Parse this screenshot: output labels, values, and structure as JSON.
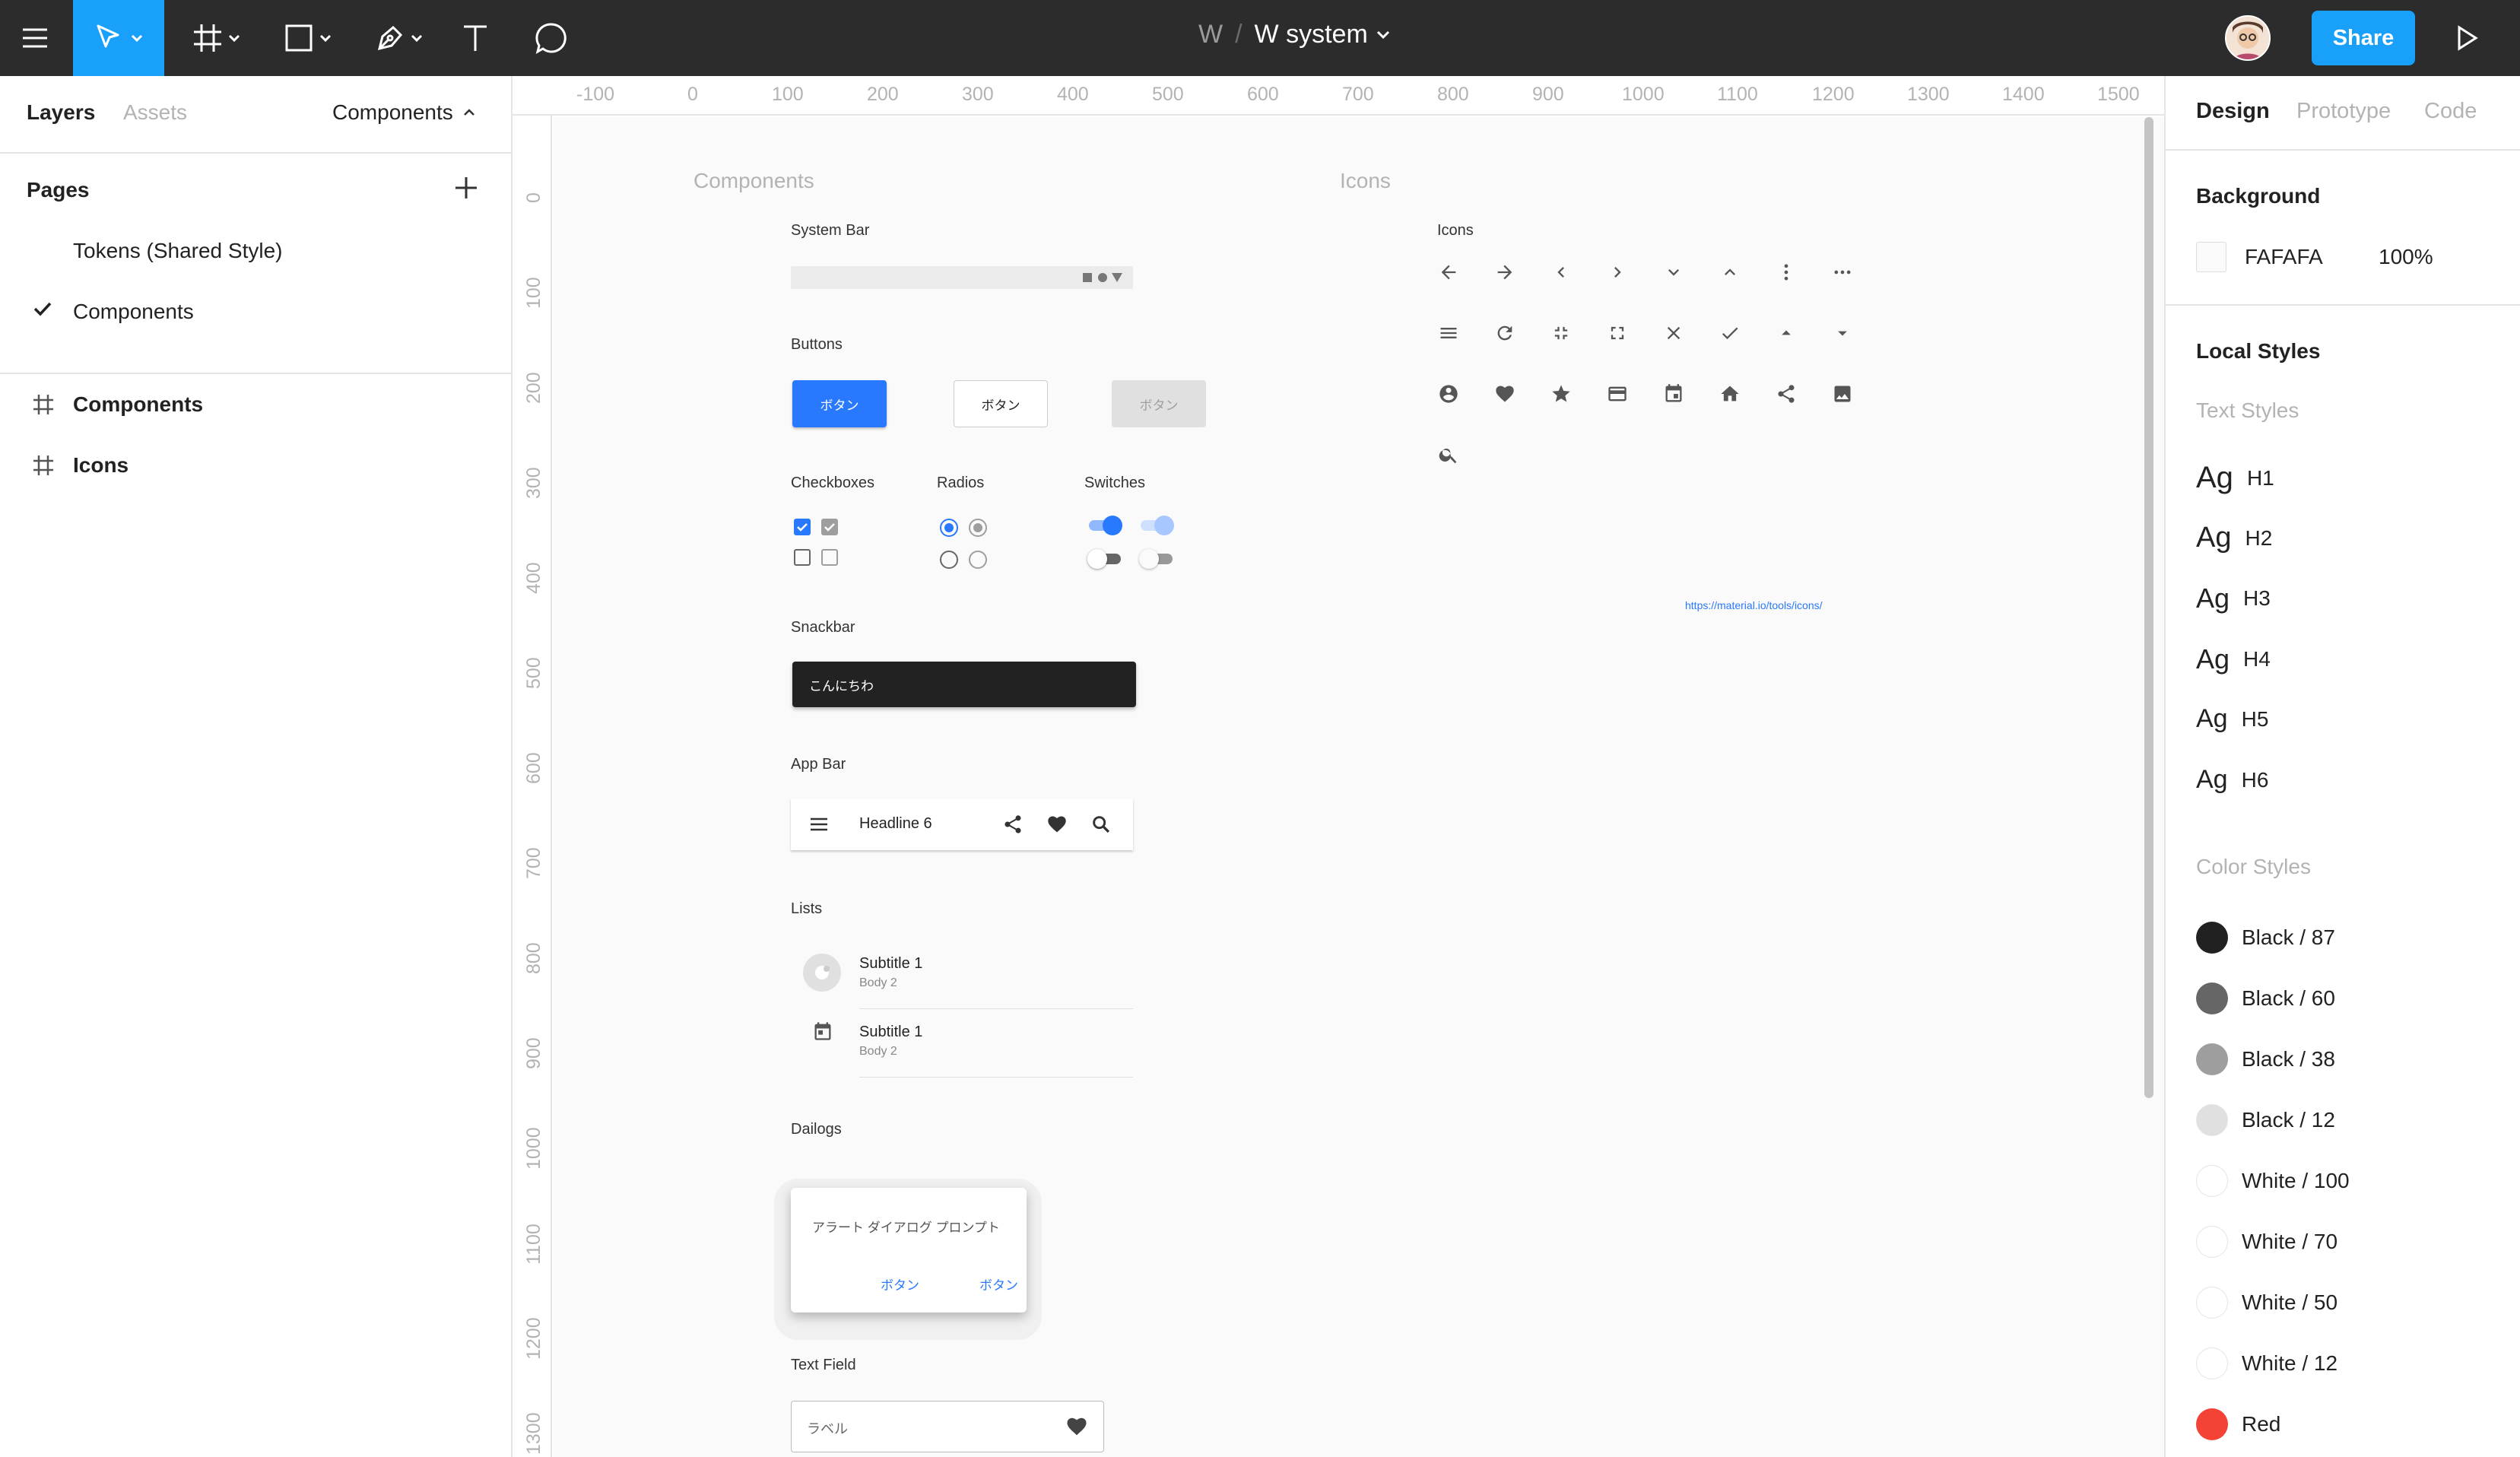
{
  "app": {
    "breadcrumb_team": "W",
    "breadcrumb_sep": "/",
    "file_name": "W system",
    "share_label": "Share"
  },
  "left_panel": {
    "tab_layers": "Layers",
    "tab_assets": "Assets",
    "page_selector": "Components",
    "pages_title": "Pages",
    "pages": [
      "Tokens (Shared Style)",
      "Components"
    ],
    "layers": [
      "Components",
      "Icons"
    ]
  },
  "rulers": {
    "horizontal": [
      "-100",
      "0",
      "100",
      "200",
      "300",
      "400",
      "500",
      "600",
      "700",
      "800",
      "900",
      "1000",
      "1100",
      "1200",
      "1300",
      "1400",
      "1500"
    ],
    "vertical": [
      "0",
      "100",
      "200",
      "300",
      "400",
      "500",
      "600",
      "700",
      "800",
      "900",
      "1000",
      "1100",
      "1200",
      "1300"
    ]
  },
  "canvas": {
    "frame_components": "Components",
    "frame_icons": "Icons",
    "system_bar_label": "System Bar",
    "buttons_label": "Buttons",
    "button_text": "ボタン",
    "checkboxes_label": "Checkboxes",
    "radios_label": "Radios",
    "switches_label": "Switches",
    "snackbar_label": "Snackbar",
    "snackbar_text": "こんにちわ",
    "appbar_label": "App Bar",
    "appbar_title": "Headline 6",
    "lists_label": "Lists",
    "list_items": [
      {
        "subtitle": "Subtitle 1",
        "body": "Body 2"
      },
      {
        "subtitle": "Subtitle 1",
        "body": "Body 2"
      }
    ],
    "dialogs_label": "Dailogs",
    "dialog_text": "アラート ダイアログ プロンプト",
    "dialog_btn1": "ボタン",
    "dialog_btn2": "ボタン",
    "textfield_label": "Text Field",
    "textfield_placeholder": "ラベル",
    "icons_label": "Icons",
    "icons_link": "https://material.io/tools/icons/"
  },
  "right_panel": {
    "tab_design": "Design",
    "tab_prototype": "Prototype",
    "tab_code": "Code",
    "background_title": "Background",
    "background_hex": "FAFAFA",
    "background_opacity": "100%",
    "local_styles_title": "Local Styles",
    "text_styles_title": "Text Styles",
    "text_styles": [
      {
        "sample": "Ag",
        "name": "H1"
      },
      {
        "sample": "Ag",
        "name": "H2"
      },
      {
        "sample": "Ag",
        "name": "H3"
      },
      {
        "sample": "Ag",
        "name": "H4"
      },
      {
        "sample": "Ag",
        "name": "H5"
      },
      {
        "sample": "Ag",
        "name": "H6"
      }
    ],
    "color_styles_title": "Color Styles",
    "color_styles": [
      {
        "name": "Black / 87",
        "color": "#212121"
      },
      {
        "name": "Black / 60",
        "color": "#666666"
      },
      {
        "name": "Black / 38",
        "color": "#9e9e9e"
      },
      {
        "name": "Black / 12",
        "color": "#e0e0e0"
      },
      {
        "name": "White / 100",
        "color": "#ffffff"
      },
      {
        "name": "White / 70",
        "color": "#ffffff"
      },
      {
        "name": "White / 50",
        "color": "#ffffff"
      },
      {
        "name": "White / 12",
        "color": "#ffffff"
      },
      {
        "name": "Red",
        "color": "#f44336"
      }
    ]
  },
  "colors": {
    "accent": "#18a0fb",
    "primary": "#2979ff",
    "topbar": "#2c2c2c"
  }
}
